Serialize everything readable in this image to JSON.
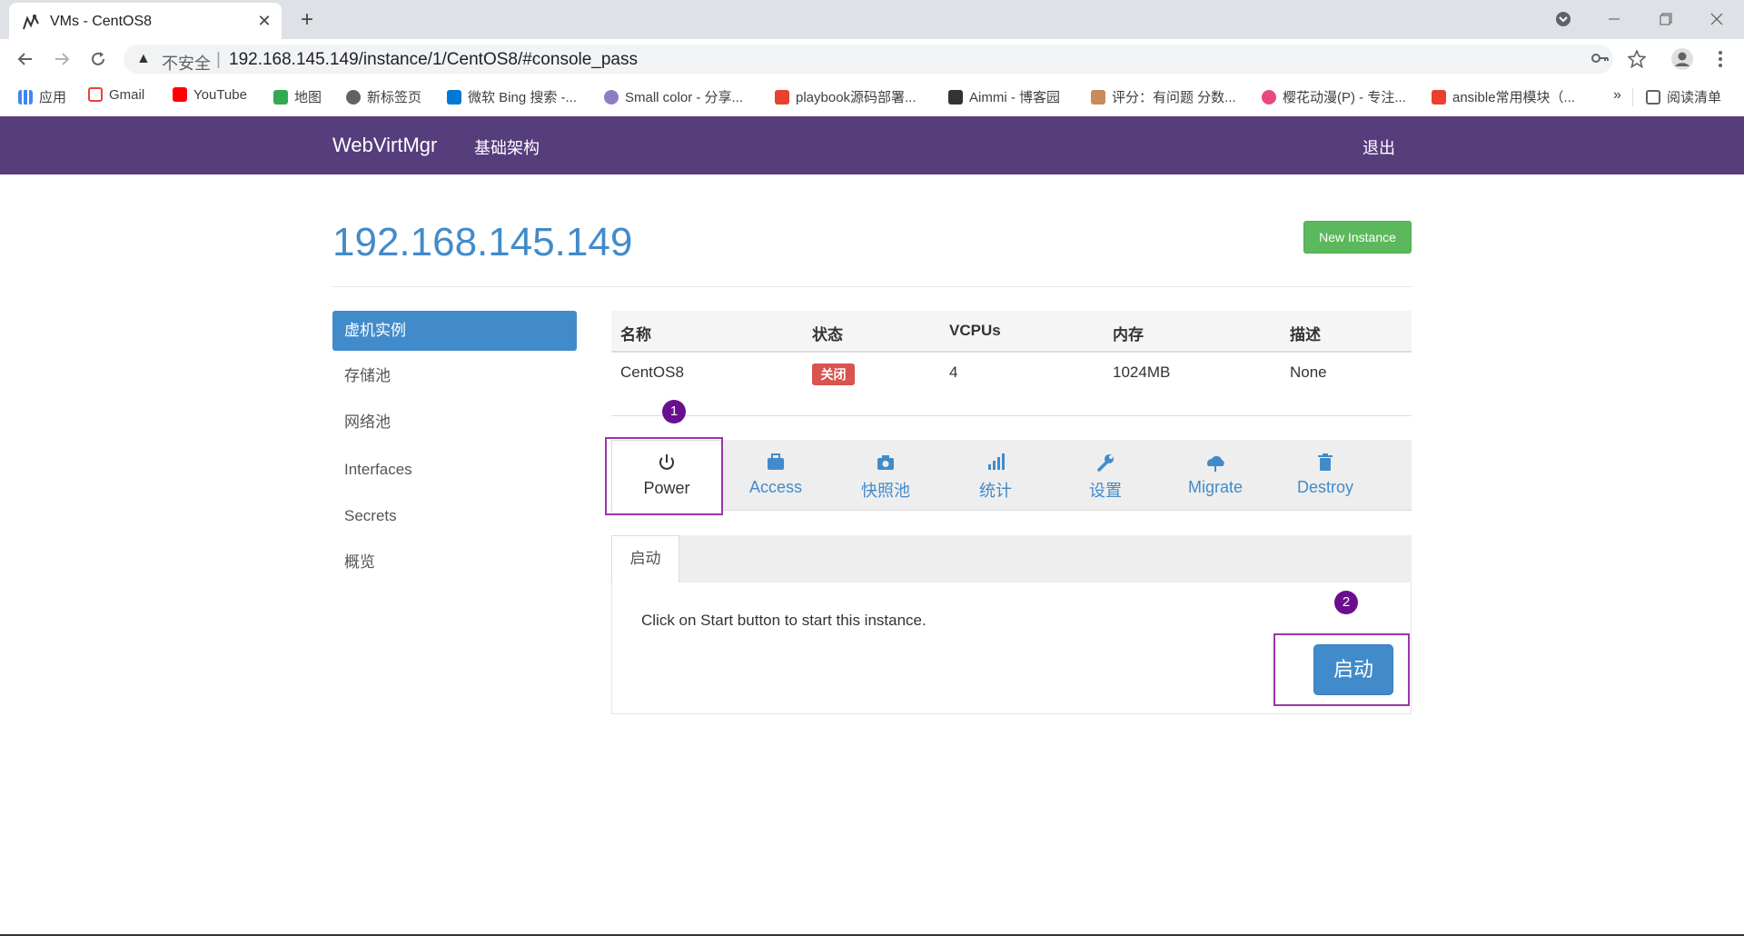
{
  "browser": {
    "tab_title": "VMs - CentOS8",
    "tab_close": "✕",
    "new_tab": "+",
    "not_secure": "不安全",
    "url": "192.168.145.149/instance/1/CentOS8/#console_pass",
    "bookmarks": [
      {
        "label": "应用",
        "color": "#4285f4"
      },
      {
        "label": "Gmail",
        "color": "#ea4335"
      },
      {
        "label": "YouTube",
        "color": "#ff0000"
      },
      {
        "label": "地图",
        "color": "#34a853"
      },
      {
        "label": "新标签页",
        "color": "#5f6368"
      },
      {
        "label": "微软 Bing 搜索 -...",
        "color": "#0078d4"
      },
      {
        "label": "Small color - 分享...",
        "color": "#8e7cc3"
      },
      {
        "label": "playbook源码部署...",
        "color": "#e8412c"
      },
      {
        "label": "Aimmi - 博客园",
        "color": "#333333"
      },
      {
        "label": "评分：有问题 分数...",
        "color": "#c98b5c"
      },
      {
        "label": "樱花动漫(P) - 专注...",
        "color": "#e84a7f"
      },
      {
        "label": "ansible常用模块（...",
        "color": "#e8412c"
      }
    ],
    "more_bookmarks": "»",
    "reading_list": "阅读清单"
  },
  "navbar": {
    "brand": "WebVirtMgr",
    "infrastructure": "基础架构",
    "logout": "退出"
  },
  "page": {
    "host_title": "192.168.145.149",
    "new_instance": "New Instance"
  },
  "sidebar": {
    "items": [
      {
        "label": "虚机实例"
      },
      {
        "label": "存储池"
      },
      {
        "label": "网络池"
      },
      {
        "label": "Interfaces"
      },
      {
        "label": "Secrets"
      },
      {
        "label": "概览"
      }
    ]
  },
  "table": {
    "headers": [
      "名称",
      "状态",
      "VCPUs",
      "内存",
      "描述"
    ],
    "row": {
      "name": "CentOS8",
      "status": "关闭",
      "vcpus": "4",
      "memory": "1024MB",
      "description": "None"
    }
  },
  "actions": [
    {
      "label": "Power",
      "icon": "power-icon"
    },
    {
      "label": "Access",
      "icon": "briefcase-icon"
    },
    {
      "label": "快照池",
      "icon": "camera-icon"
    },
    {
      "label": "统计",
      "icon": "stats-icon"
    },
    {
      "label": "设置",
      "icon": "wrench-icon"
    },
    {
      "label": "Migrate",
      "icon": "cloud-upload-icon"
    },
    {
      "label": "Destroy",
      "icon": "trash-icon"
    }
  ],
  "power_panel": {
    "tab_label": "启动",
    "message": "Click on Start button to start this instance.",
    "start_button": "启动"
  },
  "annotations": {
    "marker_1": "1",
    "marker_2": "2",
    "highlight_color": "#9b35a8",
    "marker_color": "#6a0f8e"
  },
  "colors": {
    "navbar": "#563d7c",
    "primary": "#428bca",
    "success": "#5cb85c",
    "danger": "#d9534f"
  }
}
